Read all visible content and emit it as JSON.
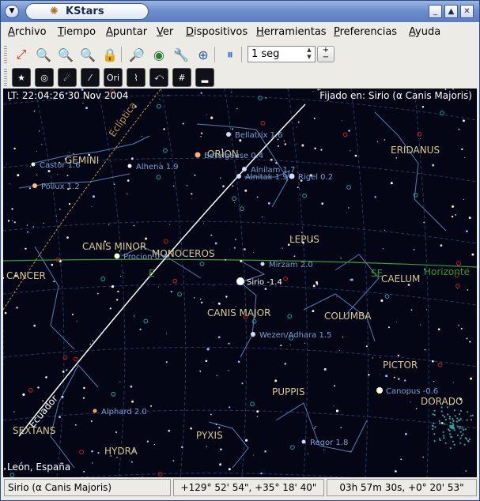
{
  "window": {
    "title": "KStars",
    "buttons": [
      {
        "name": "minimize-button",
        "glyph": "_"
      },
      {
        "name": "maximize-button",
        "glyph": "▲"
      },
      {
        "name": "close-button",
        "glyph": "✕"
      }
    ]
  },
  "menu": [
    "Archivo",
    "Tiempo",
    "Apuntar",
    "Ver",
    "Dispositivos",
    "Herramientas",
    "Preferencias",
    "Ayuda"
  ],
  "toolbar1": {
    "tools": [
      {
        "name": "zoom-default-icon",
        "glyph": "⤢",
        "color": "#d02020"
      },
      {
        "name": "zoom-in-icon",
        "glyph": "🔍",
        "color": "#2a6a2a"
      },
      {
        "name": "zoom-out-icon",
        "glyph": "🔍",
        "color": "#2a6a2a"
      },
      {
        "name": "zoom-fit-icon",
        "glyph": "🔍",
        "color": "#2a6a2a"
      },
      {
        "name": "lock-icon",
        "glyph": "🔒",
        "color": "#c99a10"
      },
      {
        "name": "find-object-icon",
        "glyph": "🔎",
        "color": "#1a4aaa"
      },
      {
        "name": "earth-icon",
        "glyph": "◉",
        "color": "#2a7a3a"
      },
      {
        "name": "tools-icon",
        "glyph": "🔧",
        "color": "#888"
      },
      {
        "name": "compass-icon",
        "glyph": "⊕",
        "color": "#2a5aaa"
      },
      {
        "name": "pause-icon",
        "glyph": "⏸",
        "color": "#2a6ad0"
      }
    ],
    "time_step": "1 seg",
    "step_buttons": [
      "+",
      "−"
    ]
  },
  "toolbar2": {
    "tools": [
      {
        "name": "stars-toggle-icon",
        "label": "★"
      },
      {
        "name": "deep-sky-toggle-icon",
        "label": "◎"
      },
      {
        "name": "solar-system-toggle-icon",
        "label": "☄"
      },
      {
        "name": "comets-toggle-icon",
        "label": "⁄"
      },
      {
        "name": "constellation-names-toggle-icon",
        "label": "Ori"
      },
      {
        "name": "constellation-lines-toggle-icon",
        "label": "⌇"
      },
      {
        "name": "milky-way-toggle-icon",
        "label": "⤺"
      },
      {
        "name": "coordinate-grid-toggle-icon",
        "label": "#"
      },
      {
        "name": "horizon-toggle-icon",
        "label": "▂"
      }
    ]
  },
  "sky": {
    "lt": "LT: 22:04:26   30 Nov 2004",
    "focus": "Fijado en: Sirio (α Canis Majoris)",
    "location": "León, España",
    "colors": {
      "background": "#040616",
      "constellation_lines": "#5a7fb0",
      "grid": "#2b3a5c",
      "equator": "#ffffff",
      "ecliptic": "#c09a4a",
      "horizon": "#3a9a3a"
    },
    "constellations": [
      "GEMINI",
      "ORION",
      "ERIDANUS",
      "CANIS MINOR",
      "MONOCEROS",
      "LEPUS",
      "CANCER",
      "CAELUM",
      "CANIS MAJOR",
      "COLUMBA",
      "PICTOR",
      "PUPPIS",
      "DORADO",
      "SEXTANS",
      "PYXIS",
      "HYDRA"
    ],
    "stars": [
      "Bellatrix 1.6",
      "Betelgeuse 0.4",
      "Alnilam 1.7",
      "Alnitak 1.9",
      "Rigel 0.2",
      "Castor 1.6",
      "Alhena 1.9",
      "Pollux 1.2",
      "Procion 0.4",
      "Mirzam 2.0",
      "Sirio -1.4",
      "Wezen/Adhara 1.5",
      "Canopus -0.6",
      "Alphard 2.0",
      "Regor 1.8"
    ],
    "line_labels": [
      "Eclíptica",
      "Ecuador",
      "Horizonte",
      "E",
      "SE"
    ]
  },
  "status": {
    "object": "Sirio (α Canis Majoris)",
    "altaz": "+129° 52' 54\",  +35° 18' 40\"",
    "radec": "03h 57m 30s,  +0° 20' 53\""
  }
}
